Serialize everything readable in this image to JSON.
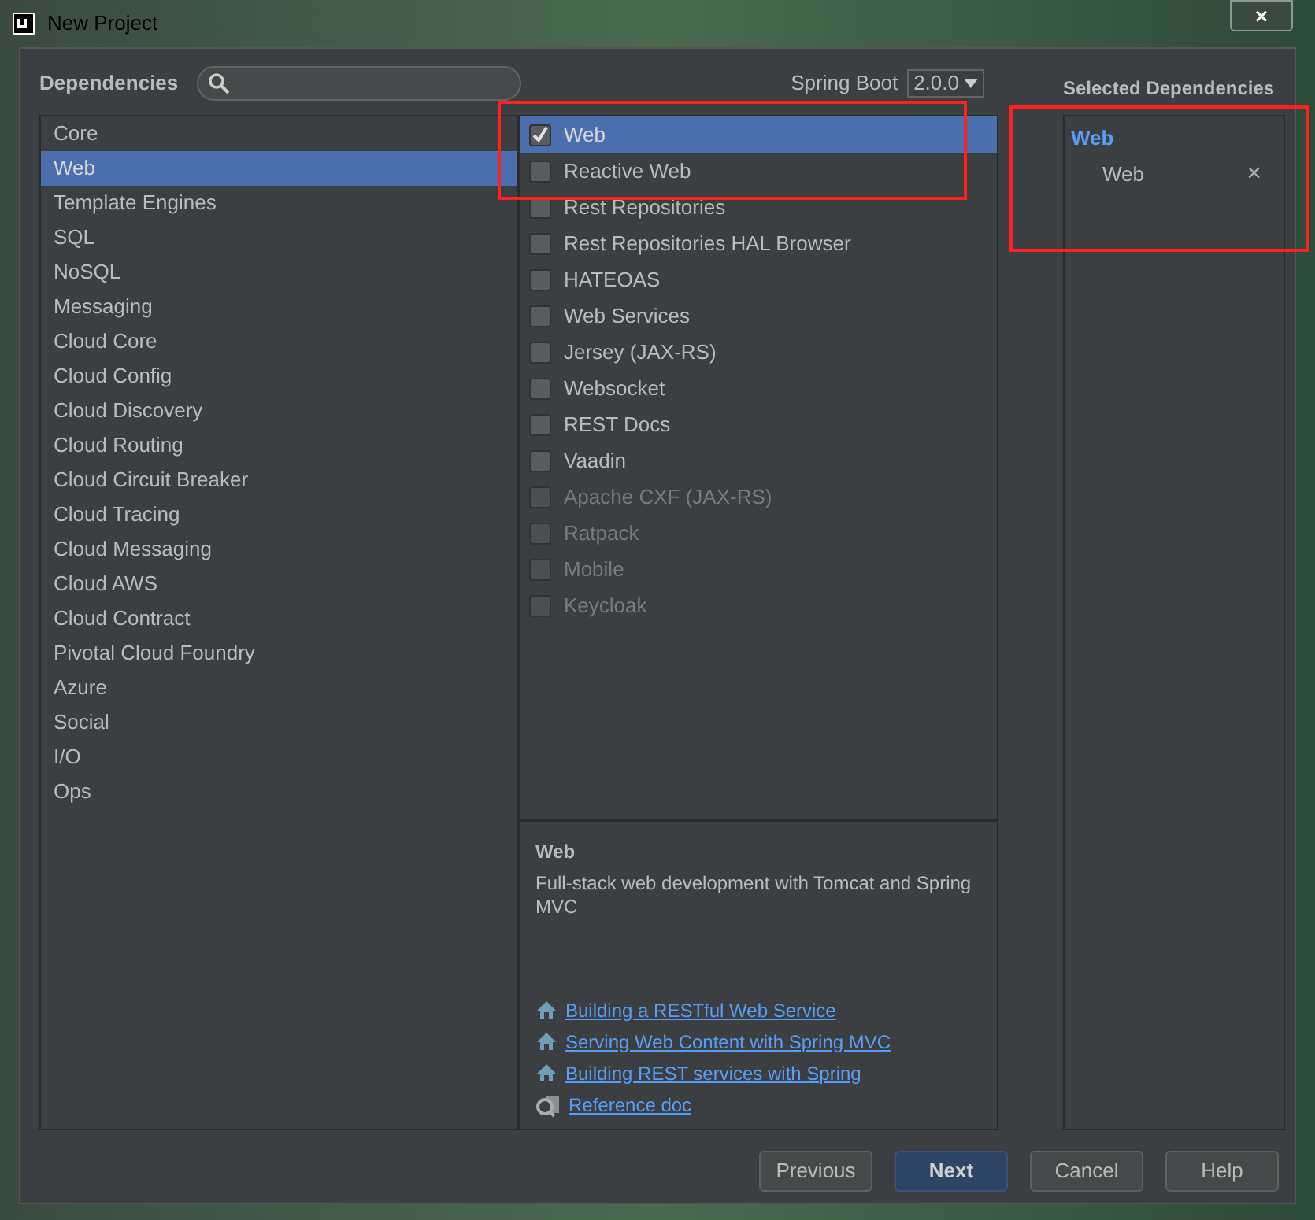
{
  "window": {
    "title": "New Project",
    "close": "×"
  },
  "header": {
    "dependencies_label": "Dependencies",
    "spring_boot_label": "Spring Boot",
    "spring_boot_version": "2.0.0",
    "selected_title": "Selected Dependencies"
  },
  "categories": [
    {
      "label": "Core",
      "selected": false
    },
    {
      "label": "Web",
      "selected": true
    },
    {
      "label": "Template Engines",
      "selected": false
    },
    {
      "label": "SQL",
      "selected": false
    },
    {
      "label": "NoSQL",
      "selected": false
    },
    {
      "label": "Messaging",
      "selected": false
    },
    {
      "label": "Cloud Core",
      "selected": false
    },
    {
      "label": "Cloud Config",
      "selected": false
    },
    {
      "label": "Cloud Discovery",
      "selected": false
    },
    {
      "label": "Cloud Routing",
      "selected": false
    },
    {
      "label": "Cloud Circuit Breaker",
      "selected": false
    },
    {
      "label": "Cloud Tracing",
      "selected": false
    },
    {
      "label": "Cloud Messaging",
      "selected": false
    },
    {
      "label": "Cloud AWS",
      "selected": false
    },
    {
      "label": "Cloud Contract",
      "selected": false
    },
    {
      "label": "Pivotal Cloud Foundry",
      "selected": false
    },
    {
      "label": "Azure",
      "selected": false
    },
    {
      "label": "Social",
      "selected": false
    },
    {
      "label": "I/O",
      "selected": false
    },
    {
      "label": "Ops",
      "selected": false
    }
  ],
  "dependencies": [
    {
      "label": "Web",
      "checked": true,
      "selected": true,
      "disabled": false
    },
    {
      "label": "Reactive Web",
      "checked": false,
      "selected": false,
      "disabled": false
    },
    {
      "label": "Rest Repositories",
      "checked": false,
      "selected": false,
      "disabled": false
    },
    {
      "label": "Rest Repositories HAL Browser",
      "checked": false,
      "selected": false,
      "disabled": false
    },
    {
      "label": "HATEOAS",
      "checked": false,
      "selected": false,
      "disabled": false
    },
    {
      "label": "Web Services",
      "checked": false,
      "selected": false,
      "disabled": false
    },
    {
      "label": "Jersey (JAX-RS)",
      "checked": false,
      "selected": false,
      "disabled": false
    },
    {
      "label": "Websocket",
      "checked": false,
      "selected": false,
      "disabled": false
    },
    {
      "label": "REST Docs",
      "checked": false,
      "selected": false,
      "disabled": false
    },
    {
      "label": "Vaadin",
      "checked": false,
      "selected": false,
      "disabled": false
    },
    {
      "label": "Apache CXF (JAX-RS)",
      "checked": false,
      "selected": false,
      "disabled": true
    },
    {
      "label": "Ratpack",
      "checked": false,
      "selected": false,
      "disabled": true
    },
    {
      "label": "Mobile",
      "checked": false,
      "selected": false,
      "disabled": true
    },
    {
      "label": "Keycloak",
      "checked": false,
      "selected": false,
      "disabled": true
    }
  ],
  "description": {
    "title": "Web",
    "text": "Full-stack web development with Tomcat and Spring MVC",
    "links": [
      {
        "kind": "guide",
        "label": "Building a RESTful Web Service"
      },
      {
        "kind": "guide",
        "label": "Serving Web Content with Spring MVC"
      },
      {
        "kind": "guide",
        "label": "Building REST services with Spring"
      },
      {
        "kind": "reference",
        "label": "Reference doc"
      }
    ]
  },
  "selected": [
    {
      "group": "Web",
      "items": [
        {
          "label": "Web",
          "remove": "×"
        }
      ]
    }
  ],
  "buttons": [
    {
      "label": "Previous",
      "default": false
    },
    {
      "label": "Next",
      "default": true
    },
    {
      "label": "Cancel",
      "default": false
    },
    {
      "label": "Help",
      "default": false
    }
  ],
  "annotations": [
    {
      "kind": "red-box"
    },
    {
      "kind": "red-box"
    }
  ]
}
